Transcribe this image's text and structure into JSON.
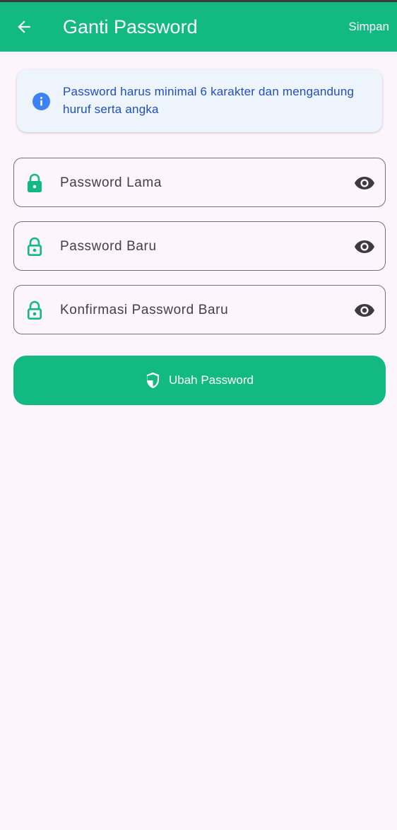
{
  "appbar": {
    "title": "Ganti Password",
    "action_label": "Simpan",
    "back_icon": "arrow-left-icon",
    "background_color": "#12b981"
  },
  "info": {
    "icon": "info-icon",
    "text": "Password harus minimal 6 karakter dan mengandung huruf serta angka"
  },
  "fields": [
    {
      "label": "Password Lama",
      "icon": "lock-icon",
      "toggle_icon": "eye-icon"
    },
    {
      "label": "Password Baru",
      "icon": "lock-open-icon",
      "toggle_icon": "eye-icon"
    },
    {
      "label": "Konfirmasi Password Baru",
      "icon": "lock-open-icon",
      "toggle_icon": "eye-icon"
    }
  ],
  "submit": {
    "label": "Ubah Password",
    "icon": "shield-icon"
  },
  "colors": {
    "primary": "#12b981",
    "info_text": "#1f4fbf",
    "info_background": "#eef4fc",
    "page_background": "#fcf5fc"
  }
}
